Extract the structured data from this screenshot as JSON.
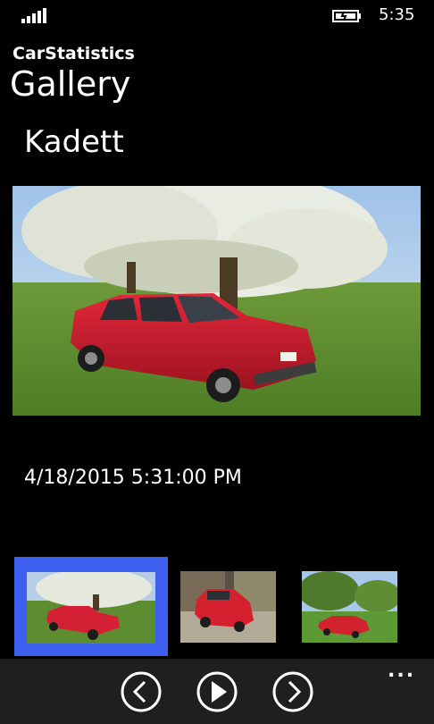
{
  "status": {
    "time": "5:35",
    "signal_icon": "signal-bars-icon",
    "battery_icon": "battery-charging-icon"
  },
  "header": {
    "app_title": "CarStatistics",
    "page_title": "Gallery"
  },
  "car": {
    "name": "Kadett"
  },
  "photo": {
    "timestamp": "4/18/2015 5:31:00 PM",
    "subject": "red-hatchback-under-blossoming-tree"
  },
  "thumbnails": [
    {
      "selected": true,
      "scene": "car-under-tree"
    },
    {
      "selected": false,
      "scene": "car-in-driveway"
    },
    {
      "selected": false,
      "scene": "car-on-meadow"
    }
  ],
  "app_bar": {
    "buttons": [
      {
        "icon": "previous-icon"
      },
      {
        "icon": "play-icon"
      },
      {
        "icon": "next-icon"
      }
    ],
    "more_label": "..."
  },
  "colors": {
    "accent": "#3d5ff0",
    "app_bar": "#1f1f1f",
    "background": "#000000"
  }
}
